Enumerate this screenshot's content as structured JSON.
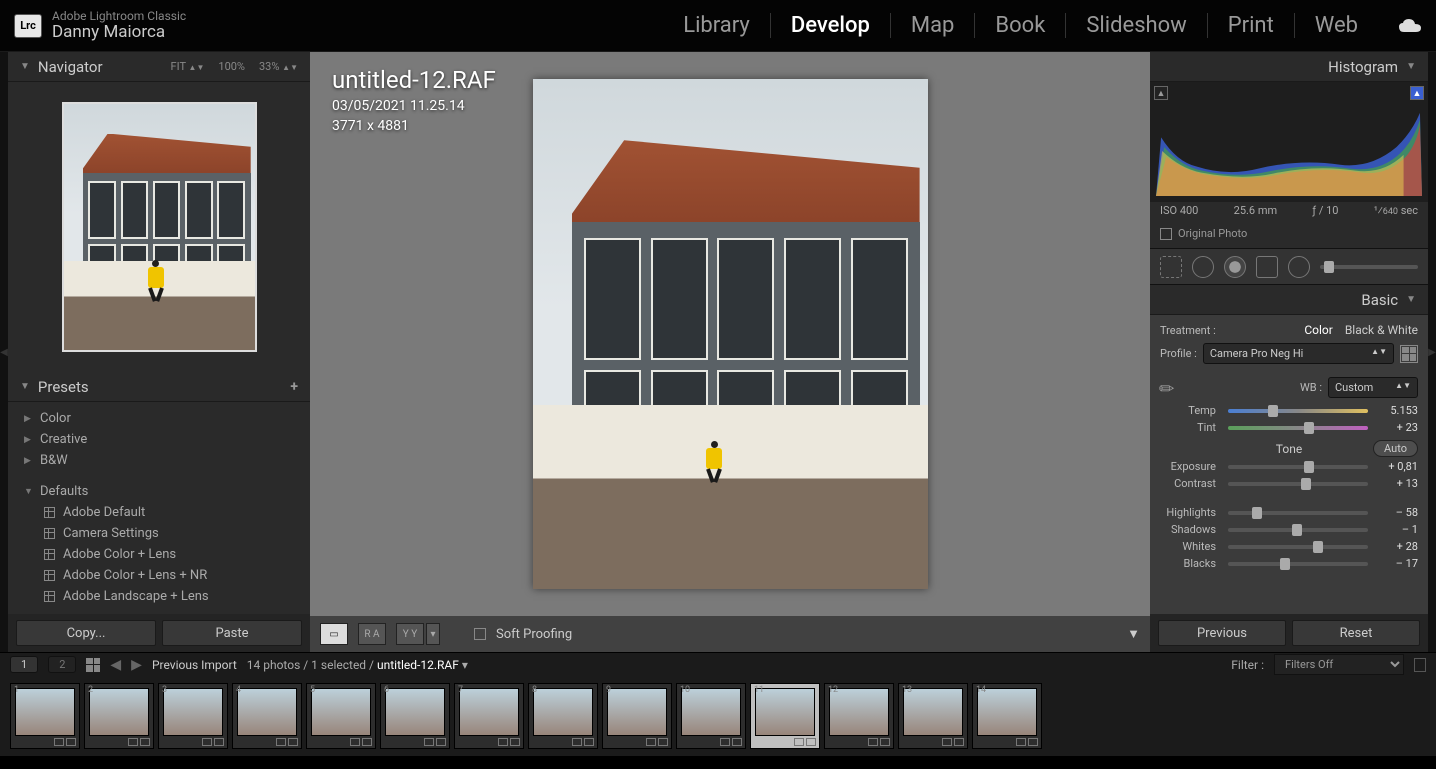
{
  "app": {
    "product_line": "Adobe Lightroom Classic",
    "user_name": "Danny Maiorca",
    "logo": "Lrc"
  },
  "modules": {
    "items": [
      "Library",
      "Develop",
      "Map",
      "Book",
      "Slideshow",
      "Print",
      "Web"
    ],
    "active": "Develop"
  },
  "navigator": {
    "title": "Navigator",
    "zoom": {
      "fit": "FIT",
      "z100": "100%",
      "z33": "33%"
    }
  },
  "presets": {
    "title": "Presets",
    "groups_collapsed": [
      "Color",
      "Creative",
      "B&W"
    ],
    "group_expanded": {
      "name": "Defaults",
      "items": [
        "Adobe Default",
        "Camera Settings",
        "Adobe Color + Lens",
        "Adobe Color + Lens + NR",
        "Adobe Landscape + Lens"
      ]
    }
  },
  "copy_paste": {
    "copy": "Copy...",
    "paste": "Paste"
  },
  "image": {
    "filename": "untitled-12.RAF",
    "datetime": "03/05/2021 11.25.14",
    "dimensions": "3771 x 4881"
  },
  "center_toolbar": {
    "soft_proof": "Soft Proofing",
    "labels": {
      "ra": "R A",
      "yy": "Y Y"
    }
  },
  "histogram": {
    "title": "Histogram",
    "exif": {
      "iso": "ISO 400",
      "focal": "25.6 mm",
      "aperture": "ƒ / 10",
      "shutter_pre": "¹⁄",
      "shutter_val": "640",
      "shutter_unit": "sec"
    },
    "original": "Original Photo"
  },
  "basic": {
    "title": "Basic",
    "treatment_label": "Treatment :",
    "treatment": {
      "color": "Color",
      "bw": "Black & White"
    },
    "profile_label": "Profile :",
    "profile_value": "Camera Pro Neg Hi",
    "wb_label": "WB :",
    "wb_value": "Custom",
    "sliders": {
      "temp": {
        "label": "Temp",
        "value": "5.153",
        "pos": 32
      },
      "tint": {
        "label": "Tint",
        "value": "+ 23",
        "pos": 58
      },
      "exposure": {
        "label": "Exposure",
        "value": "+ 0,81",
        "pos": 58
      },
      "contrast": {
        "label": "Contrast",
        "value": "+ 13",
        "pos": 56
      },
      "highlights": {
        "label": "Highlights",
        "value": "– 58",
        "pos": 21
      },
      "shadows": {
        "label": "Shadows",
        "value": "– 1",
        "pos": 49
      },
      "whites": {
        "label": "Whites",
        "value": "+ 28",
        "pos": 64
      },
      "blacks": {
        "label": "Blacks",
        "value": "– 17",
        "pos": 41
      }
    },
    "tone_label": "Tone",
    "auto_label": "Auto"
  },
  "prev_reset": {
    "previous": "Previous",
    "reset": "Reset"
  },
  "status": {
    "monitor1": "1",
    "monitor2": "2",
    "prev_import": "Previous Import",
    "count": "14 photos / 1 selected / ",
    "current": "untitled-12.RAF",
    "filter_label": "Filter :",
    "filter_value": "Filters Off"
  },
  "filmstrip": {
    "count": 14,
    "selected_index": 10
  }
}
